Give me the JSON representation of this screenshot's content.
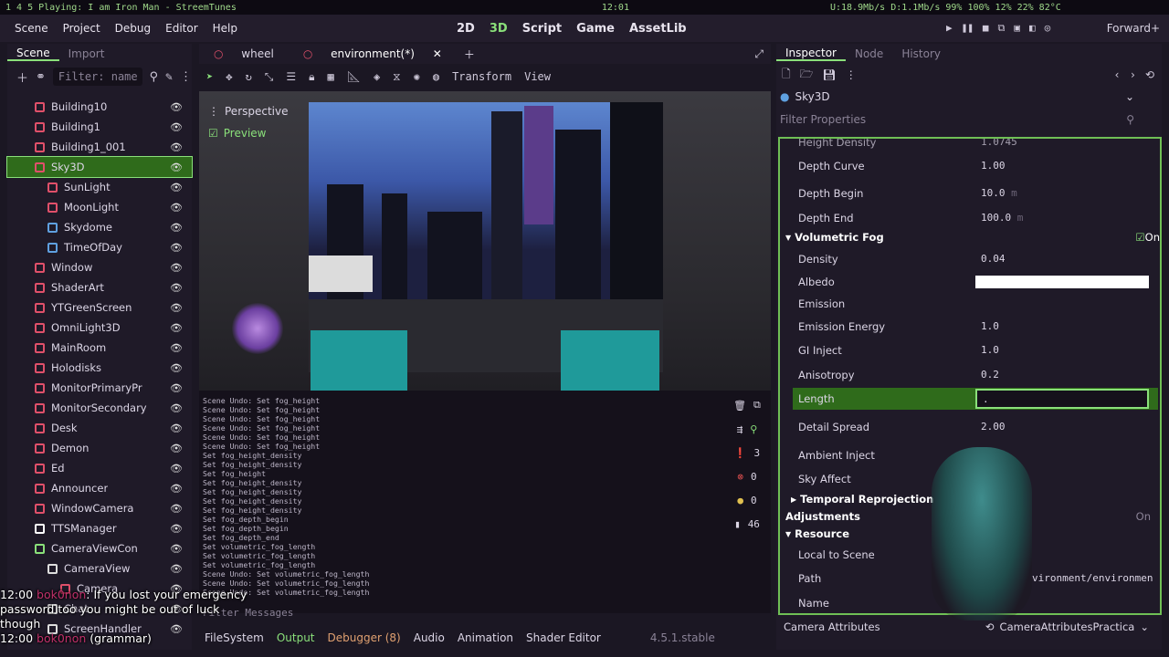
{
  "system_bar": {
    "workspaces": "1 4 5",
    "now_playing": "Playing: I am Iron Man - StreemTunes",
    "clock": "12:01",
    "net": "U:18.9Mb/s D:1.1Mb/s",
    "battery": "99%",
    "volume": "100%",
    "cpu": "12%",
    "mem": "22%",
    "temp": "82°C"
  },
  "menu": {
    "items": [
      "Scene",
      "Project",
      "Debug",
      "Editor",
      "Help"
    ],
    "workspaces": [
      "2D",
      "3D",
      "Script",
      "Game",
      "AssetLib"
    ],
    "active_workspace": "3D",
    "renderer": "Forward+"
  },
  "scene_dock": {
    "tabs": [
      "Scene",
      "Import"
    ],
    "filter_placeholder": "Filter: name",
    "nodes": [
      {
        "name": "Building10",
        "color": "#e0506a"
      },
      {
        "name": "Building1",
        "color": "#e0506a"
      },
      {
        "name": "Building1_001",
        "color": "#e0506a"
      },
      {
        "name": "Sky3D",
        "color": "#e0506a",
        "selected": true
      },
      {
        "name": "SunLight",
        "color": "#e0506a"
      },
      {
        "name": "MoonLight",
        "color": "#e0506a"
      },
      {
        "name": "Skydome",
        "color": "#5fa0e0"
      },
      {
        "name": "TimeOfDay",
        "color": "#5fa0e0"
      },
      {
        "name": "Window",
        "color": "#e0506a"
      },
      {
        "name": "ShaderArt",
        "color": "#e0506a"
      },
      {
        "name": "YTGreenScreen",
        "color": "#e0506a"
      },
      {
        "name": "OmniLight3D",
        "color": "#e0506a"
      },
      {
        "name": "MainRoom",
        "color": "#e0506a"
      },
      {
        "name": "Holodisks",
        "color": "#e0506a"
      },
      {
        "name": "MonitorPrimaryPr",
        "color": "#e0506a"
      },
      {
        "name": "MonitorSecondary",
        "color": "#e0506a"
      },
      {
        "name": "Desk",
        "color": "#e0506a"
      },
      {
        "name": "Demon",
        "color": "#e0506a"
      },
      {
        "name": "Ed",
        "color": "#e0506a"
      },
      {
        "name": "Announcer",
        "color": "#e0506a"
      },
      {
        "name": "WindowCamera",
        "color": "#e0506a"
      },
      {
        "name": "TTSManager",
        "color": "#ffffff"
      },
      {
        "name": "CameraViewCon",
        "color": "#8ae07a"
      },
      {
        "name": "CameraView",
        "color": "#dddddd"
      },
      {
        "name": "Camera",
        "color": "#e0506a"
      },
      {
        "name": "Chat",
        "color": "#dddddd"
      },
      {
        "name": "ScreenHandler",
        "color": "#dddddd"
      }
    ]
  },
  "center": {
    "tabs": [
      "wheel",
      "environment(*)"
    ],
    "active_tab": "environment(*)",
    "toolbar_labels": [
      "Transform",
      "View"
    ],
    "viewport_overlay": {
      "perspective": "Perspective",
      "preview": "Preview"
    },
    "console_lines": [
      "Scene Undo: Set fog_height",
      "Scene Undo: Set fog_height",
      "Scene Undo: Set fog_height",
      "Scene Undo: Set fog_height",
      "Scene Undo: Set fog_height",
      "Scene Undo: Set fog_height",
      "Set fog_height_density",
      "Set fog_height_density",
      "Set fog_height",
      "Set fog_height_density",
      "Set fog_height_density",
      "Set fog_height_density",
      "Set fog_height_density",
      "Set fog_depth_begin",
      "Set fog_depth_begin",
      "Set fog_depth_end",
      "Set volumetric_fog_length",
      "Set volumetric_fog_length",
      "Set volumetric_fog_length",
      "Scene Undo: Set volumetric_fog_length",
      "Scene Undo: Set volumetric_fog_length",
      "Scene Undo: Set volumetric_fog_length"
    ],
    "console_counts": {
      "errors": "3",
      "errors2": "0",
      "warnings": "0",
      "messages": "46"
    },
    "filter_messages": "Filter Messages",
    "bottom_tabs": [
      "FileSystem",
      "Output",
      "Debugger (8)",
      "Audio",
      "Animation",
      "Shader Editor"
    ],
    "version": "4.5.1.stable"
  },
  "inspector": {
    "tabs": [
      "Inspector",
      "Node",
      "History"
    ],
    "resource": "Sky3D",
    "filter_placeholder": "Filter Properties",
    "top_partial": {
      "label": "Height Density",
      "value": "1.0745"
    },
    "rows": [
      {
        "label": "Depth Curve",
        "value": "1.00",
        "unit": ""
      },
      {
        "label": "Depth Begin",
        "value": "10.0",
        "unit": "m"
      },
      {
        "label": "Depth End",
        "value": "100.0",
        "unit": "m"
      }
    ],
    "volumetric_fog": {
      "title": "Volumetric Fog",
      "toggle": "On"
    },
    "fog_rows": [
      {
        "label": "Density",
        "value": "0.04"
      },
      {
        "label": "Albedo",
        "value": ""
      },
      {
        "label": "Emission",
        "value": ""
      },
      {
        "label": "Emission Energy",
        "value": "1.0"
      },
      {
        "label": "GI Inject",
        "value": "1.0"
      },
      {
        "label": "Anisotropy",
        "value": "0.2"
      },
      {
        "label": "Length",
        "value": "."
      },
      {
        "label": "Detail Spread",
        "value": "2.00"
      },
      {
        "label": "Ambient Inject",
        "value": "0.0"
      },
      {
        "label": "Sky Affect",
        "value": "1.0"
      }
    ],
    "temporal": "Temporal Reprojection",
    "adjustments": {
      "title": "Adjustments",
      "toggle": "On"
    },
    "resource_section": "Resource",
    "resource_rows": [
      {
        "label": "Local to Scene",
        "value": ""
      },
      {
        "label": "Path",
        "value": "vironment/environmen"
      },
      {
        "label": "Name",
        "value": ""
      }
    ],
    "camera_attributes": {
      "label": "Camera Attributes",
      "value": "CameraAttributesPractica"
    }
  },
  "chat": [
    {
      "time": "12:00",
      "user": "bok0non",
      "text": ": If you lost your emergency password too you might be out of luck though"
    },
    {
      "time": "12:00",
      "user": "bok0non",
      "text": "(grammar)"
    }
  ],
  "colors": {
    "accent": "#8ae07a",
    "selection": "#2f6b1b",
    "node": "#e0506a"
  }
}
